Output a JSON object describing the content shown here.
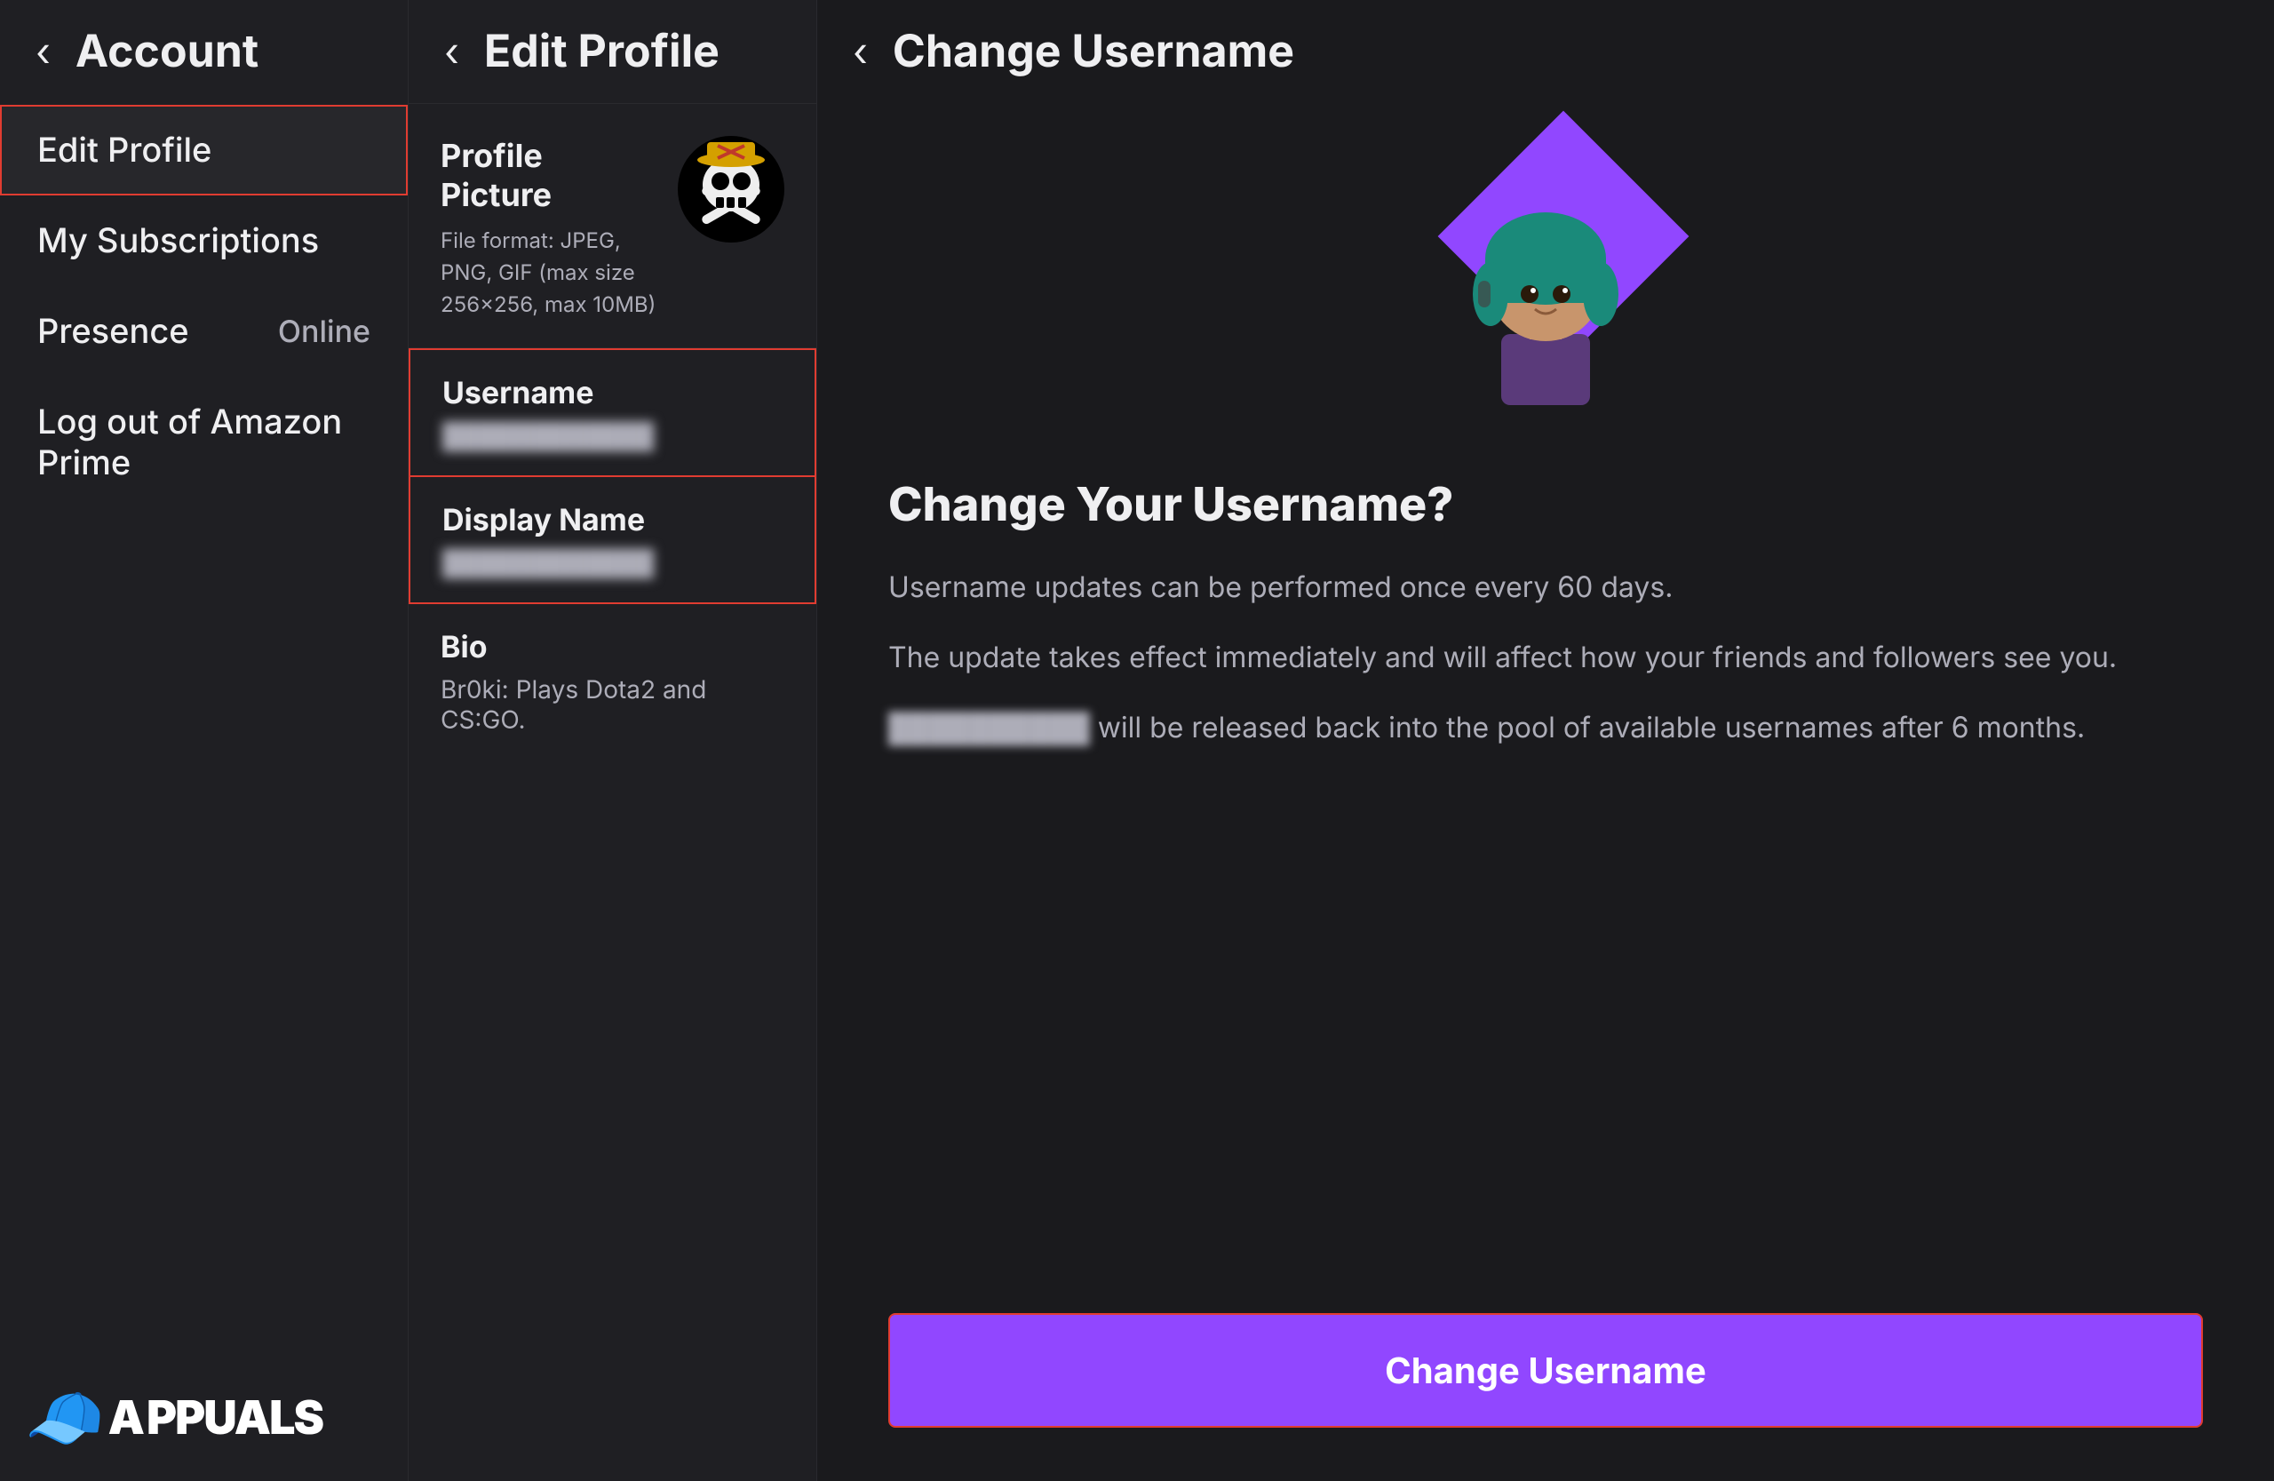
{
  "left_panel": {
    "header": {
      "back_label": "‹",
      "title": "Account"
    },
    "nav_items": [
      {
        "id": "edit-profile",
        "label": "Edit Profile",
        "value": "",
        "active": true
      },
      {
        "id": "my-subscriptions",
        "label": "My Subscriptions",
        "value": ""
      },
      {
        "id": "presence",
        "label": "Presence",
        "value": "Online"
      },
      {
        "id": "log-out-amazon",
        "label": "Log out of Amazon Prime",
        "value": ""
      }
    ]
  },
  "middle_panel": {
    "header": {
      "back_label": "‹",
      "title": "Edit Profile"
    },
    "profile_picture": {
      "label": "Profile Picture",
      "sublabel": "File format: JPEG, PNG, GIF (max size 256x256, max 10MB)"
    },
    "username_field": {
      "label": "Username",
      "value": "████████████"
    },
    "display_name_field": {
      "label": "Display Name",
      "value": "████████████"
    },
    "bio": {
      "label": "Bio",
      "value": "Br0ki: Plays Dota2 and CS:GO."
    }
  },
  "right_panel": {
    "header": {
      "back_label": "‹",
      "title": "Change Username"
    },
    "heading": "Change Your Username?",
    "info_1": "Username updates can be performed once every 60 days.",
    "info_2": "The update takes effect immediately and will affect how your friends and followers see you.",
    "info_3_prefix": "",
    "info_3_blurred": "██████████",
    "info_3_suffix": " will be released back into the pool of available usernames after 6 months.",
    "button_label": "Change Username"
  },
  "watermark": {
    "text_a": "A",
    "text_ppuals": "PPUALS"
  }
}
